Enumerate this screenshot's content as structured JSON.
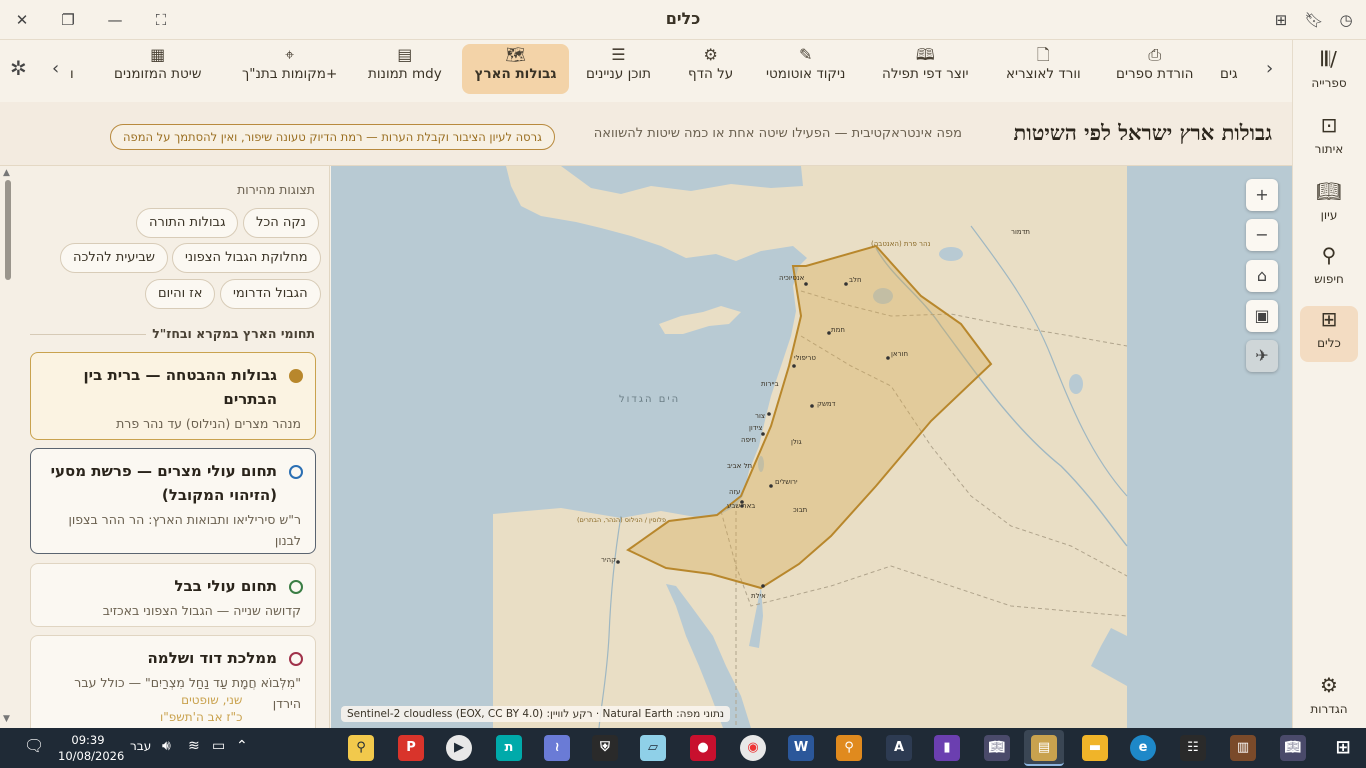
{
  "window": {
    "title": "כלים"
  },
  "right_nav": {
    "items": [
      {
        "label": "ספרייה",
        "icon": "library-icon"
      },
      {
        "label": "איתור",
        "icon": "locate-icon"
      },
      {
        "label": "עיון",
        "icon": "book-open-icon"
      },
      {
        "label": "חיפוש",
        "icon": "search-icon"
      },
      {
        "label": "כלים",
        "icon": "tools-icon"
      }
    ],
    "settings_label": "הגדרות"
  },
  "toolbar": {
    "tools": [
      {
        "label": "גים",
        "icon": ""
      },
      {
        "label": "הורדת ספרים",
        "icon": "download-doc-icon"
      },
      {
        "label": "וורד לאוצריא",
        "icon": "document-icon"
      },
      {
        "label": "יוצר דפי תפילה",
        "icon": "open-book-icon"
      },
      {
        "label": "ניקוד אוטומטי",
        "icon": "vowel-pen-icon"
      },
      {
        "label": "על הדף",
        "icon": "puzzle-icon"
      },
      {
        "label": "תוכן עניינים",
        "icon": "list-icon"
      },
      {
        "label": "גבולות הארץ",
        "icon": "map-icon"
      },
      {
        "label": "תמונות mdy",
        "icon": "image-doc-icon"
      },
      {
        "label": "מקומות בתנ\"ך+",
        "icon": "map-pin-icon"
      },
      {
        "label": "שיטת המזומנים",
        "icon": "calculator-icon"
      },
      {
        "label": "ו",
        "icon": ""
      }
    ],
    "active_index": 7
  },
  "header": {
    "title": "גבולות ארץ ישראל לפי השיטות",
    "subtitle": "מפה אינטראקטיבית — הפעילו שיטה אחת או כמה שיטות להשוואה",
    "disclaimer": "גרסה לעיון הציבור וקבלת הערות — רמת הדיוק טעונה שיפור, ואין להסתמך על המפה"
  },
  "sidebar": {
    "quick_views_heading": "תצוגות מהירות",
    "chips": [
      "נקה הכל",
      "גבולות התורה",
      "מחלוקת הגבול הצפוני",
      "שביעית להלכה",
      "הגבול הדרומי",
      "אז והיום"
    ],
    "section_heading": "תחומי הארץ במקרא ובחז\"ל",
    "cards": [
      {
        "title": "גבולות ההבטחה — ברית בין הבתרים",
        "desc": "מנהר מצרים (הנילוס) עד נהר פרת",
        "color": "#b8872c",
        "filled": true
      },
      {
        "title": "תחום עולי מצרים — פרשת מסעי (הזיהוי המקובל)",
        "desc": "ר\"ש סיריליאו ותבואות הארץ: הר ההר בצפון לבנון",
        "color": "#2b6fb3",
        "filled": false
      },
      {
        "title": "תחום עולי בבל",
        "desc": "קדושה שנייה — הגבול הצפוני באכזיב",
        "color": "#3a7d44",
        "filled": false
      },
      {
        "title": "ממלכת דוד ושלמה",
        "desc": "\"מִלְּבוֹא חֲמָת עַד נַחַל מִצְרַיִם\" — כולל עבר הירדן",
        "color": "#a0324a",
        "filled": false
      }
    ],
    "popover_lines": [
      "שני, שופטים",
      "כ\"ז אב ה'תשפ\"ו"
    ]
  },
  "map": {
    "attribution": "נתוני מפה: Natural Earth · רקע לוויין: Sentinel-2 cloudless (EOX, CC BY 4.0)",
    "controls": [
      {
        "label": "+",
        "name": "zoom-in-button"
      },
      {
        "label": "−",
        "name": "zoom-out-button"
      },
      {
        "label": "⌂",
        "name": "home-button"
      },
      {
        "label": "▣",
        "name": "layer-toggle-button"
      },
      {
        "label": "✈",
        "name": "satellite-toggle-button"
      }
    ],
    "labels": {
      "sea": "הים הגדול",
      "euphrates": "נהר פרת (האנטבה)",
      "antakya": "אנטיוכיה",
      "aleppo": "חלב",
      "hamath": "חמת",
      "tripoli": "טריפולי",
      "beirut": "ביירות",
      "damascus": "דמשק",
      "tyre": "צור",
      "sidon": "צידון",
      "haifa": "חיפה",
      "telaviv": "תל אביב",
      "jerusalem": "ירושלים",
      "gaza": "עזה",
      "beersheba": "באר שבע",
      "eilat": "אילת",
      "cairo": "קהיר",
      "golan": "גולן",
      "hauran": "חוראן",
      "nile_wadi": "פלוסין / הנילוס (הנהר, הבתרים)",
      "palmyra": "תדמור",
      "tabuk": "תבוכ"
    }
  },
  "taskbar": {
    "time": "09:39",
    "date": "10/08/2026",
    "lang": "עבר"
  }
}
